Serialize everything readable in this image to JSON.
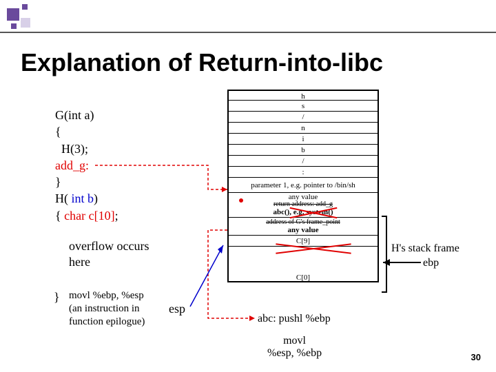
{
  "title": "Explanation of Return-into-libc",
  "code": {
    "l1": "G(int a)",
    "l2": "{",
    "l3": "  H(3);",
    "l4": "add_g:",
    "l5": "}",
    "l6a": "H( ",
    "l6b": "int b",
    "l6c": ")",
    "l7a": "{ ",
    "l7b": "char c[10]",
    "l7c": ";"
  },
  "overflow": {
    "l1": "overflow occurs",
    "l2": "here"
  },
  "epilogue": {
    "brace": "}",
    "l1": "movl %ebp, %esp",
    "l2": "(an instruction in",
    "l3": "function epilogue)",
    "esp": "esp"
  },
  "stack": {
    "c0": "h",
    "c1": "s",
    "c2": "/",
    "c3": "n",
    "c4": "i",
    "c5": "b",
    "c6": "/",
    "c7": ":",
    "param": "parameter 1, e.g. pointer to /bin/sh",
    "anyvalue": "any value",
    "retaddr_strike": "return address: add_g",
    "retaddr_new": "abc(), e.g. system()",
    "frame_strike": "address of G's frame_point",
    "frame_new": "any value",
    "c9": "C[9]",
    "c0b": "C[0]"
  },
  "side": {
    "hframe": "H's stack frame",
    "ebp": "ebp"
  },
  "abc": "abc: pushl %ebp",
  "movl": {
    "l1": "movl",
    "l2": "%esp, %ebp"
  },
  "pagenum": "30"
}
